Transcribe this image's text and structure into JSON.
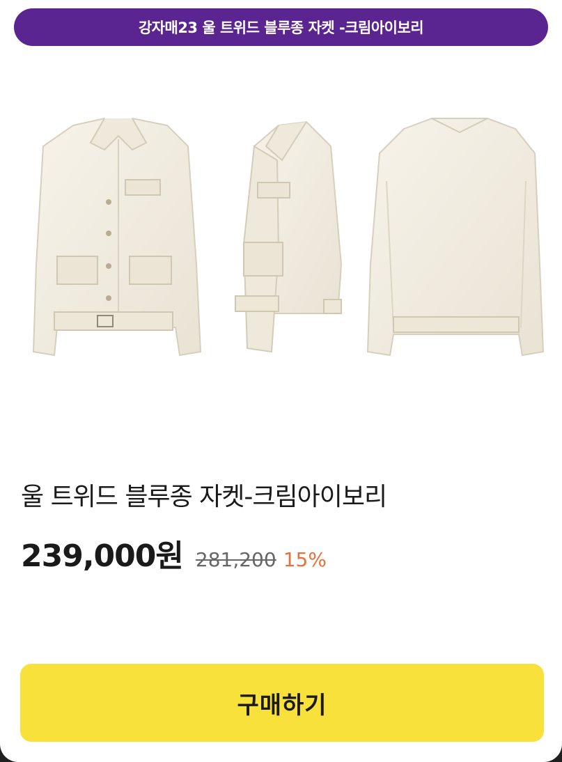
{
  "banner": {
    "text": "강자매23 울 트위드 블루종 자켓 -크림아이보리"
  },
  "product": {
    "title": "울 트위드 블루종 자켓-크림아이보리",
    "price": "239,000원",
    "original_price": "281,200",
    "discount": "15%",
    "image_icon": "jacket-three-views",
    "jacket_color": "#f3eee2"
  },
  "actions": {
    "buy_label": "구매하기"
  },
  "colors": {
    "banner_bg": "#5a2591",
    "buy_bg": "#f7e13a",
    "discount": "#e8703b"
  }
}
